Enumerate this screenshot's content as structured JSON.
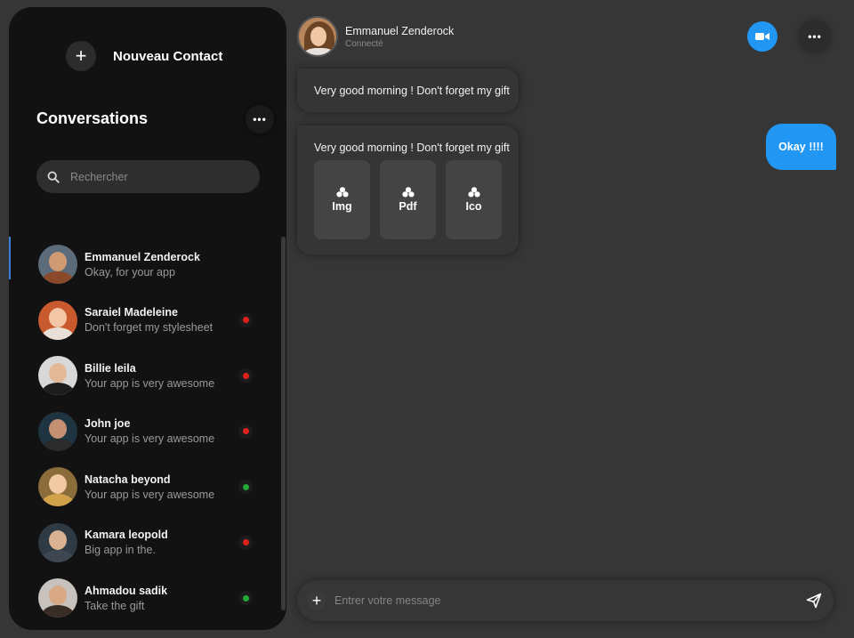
{
  "sidebar": {
    "new_contact": "Nouveau Contact",
    "title": "Conversations",
    "search_placeholder": "Rechercher",
    "conversations": [
      {
        "name": "Emmanuel Zenderock",
        "message": "Okay, for your app",
        "status": null,
        "active": true,
        "colors": {
          "bg": "#5b6b7a",
          "face": "#d09a73",
          "body": "#8a4a2a"
        }
      },
      {
        "name": "Saraiel Madeleine",
        "message": "Don't forget my stylesheet",
        "status": "offline",
        "status_color": "#e0211b",
        "colors": {
          "bg": "#c95a2e",
          "face": "#f3c6a6",
          "body": "#e8dfd6"
        }
      },
      {
        "name": "Billie leila",
        "message": "Your app is very awesome",
        "status": "offline",
        "status_color": "#e0211b",
        "colors": {
          "bg": "#d8d8d8",
          "face": "#e3b896",
          "body": "#1c1c1c"
        }
      },
      {
        "name": "John joe",
        "message": "Your app is very awesome",
        "status": "offline",
        "status_color": "#e0211b",
        "colors": {
          "bg": "#1e3440",
          "face": "#c69172",
          "body": "#2b2b2b"
        }
      },
      {
        "name": "Natacha beyond",
        "message": "Your app is very awesome",
        "status": "online",
        "status_color": "#23a936",
        "colors": {
          "bg": "#8a6d3a",
          "face": "#f1c9a2",
          "body": "#d2a24b"
        }
      },
      {
        "name": "Kamara leopold",
        "message": "Big app in the.",
        "status": "offline",
        "status_color": "#e0211b",
        "colors": {
          "bg": "#2e3a44",
          "face": "#d8b293",
          "body": "#3d4651"
        }
      },
      {
        "name": "Ahmadou sadik",
        "message": "Take the gift",
        "status": "online",
        "status_color": "#23a936",
        "colors": {
          "bg": "#c7c2bd",
          "face": "#d9a985",
          "body": "#3a2d25"
        }
      }
    ]
  },
  "header": {
    "name": "Emmanuel Zenderock",
    "status": "Connecté"
  },
  "messages": {
    "first": "Very good morning ! Don't forget my gift",
    "second": "Very good morning ! Don't forget my gift",
    "attachments": [
      "Img",
      "Pdf",
      "Ico"
    ],
    "reply": "Okay !!!!"
  },
  "composer": {
    "placeholder": "Entrer votre message"
  },
  "colors": {
    "accent": "#2196f3",
    "background": "#363636",
    "sidebar": "#121212"
  }
}
